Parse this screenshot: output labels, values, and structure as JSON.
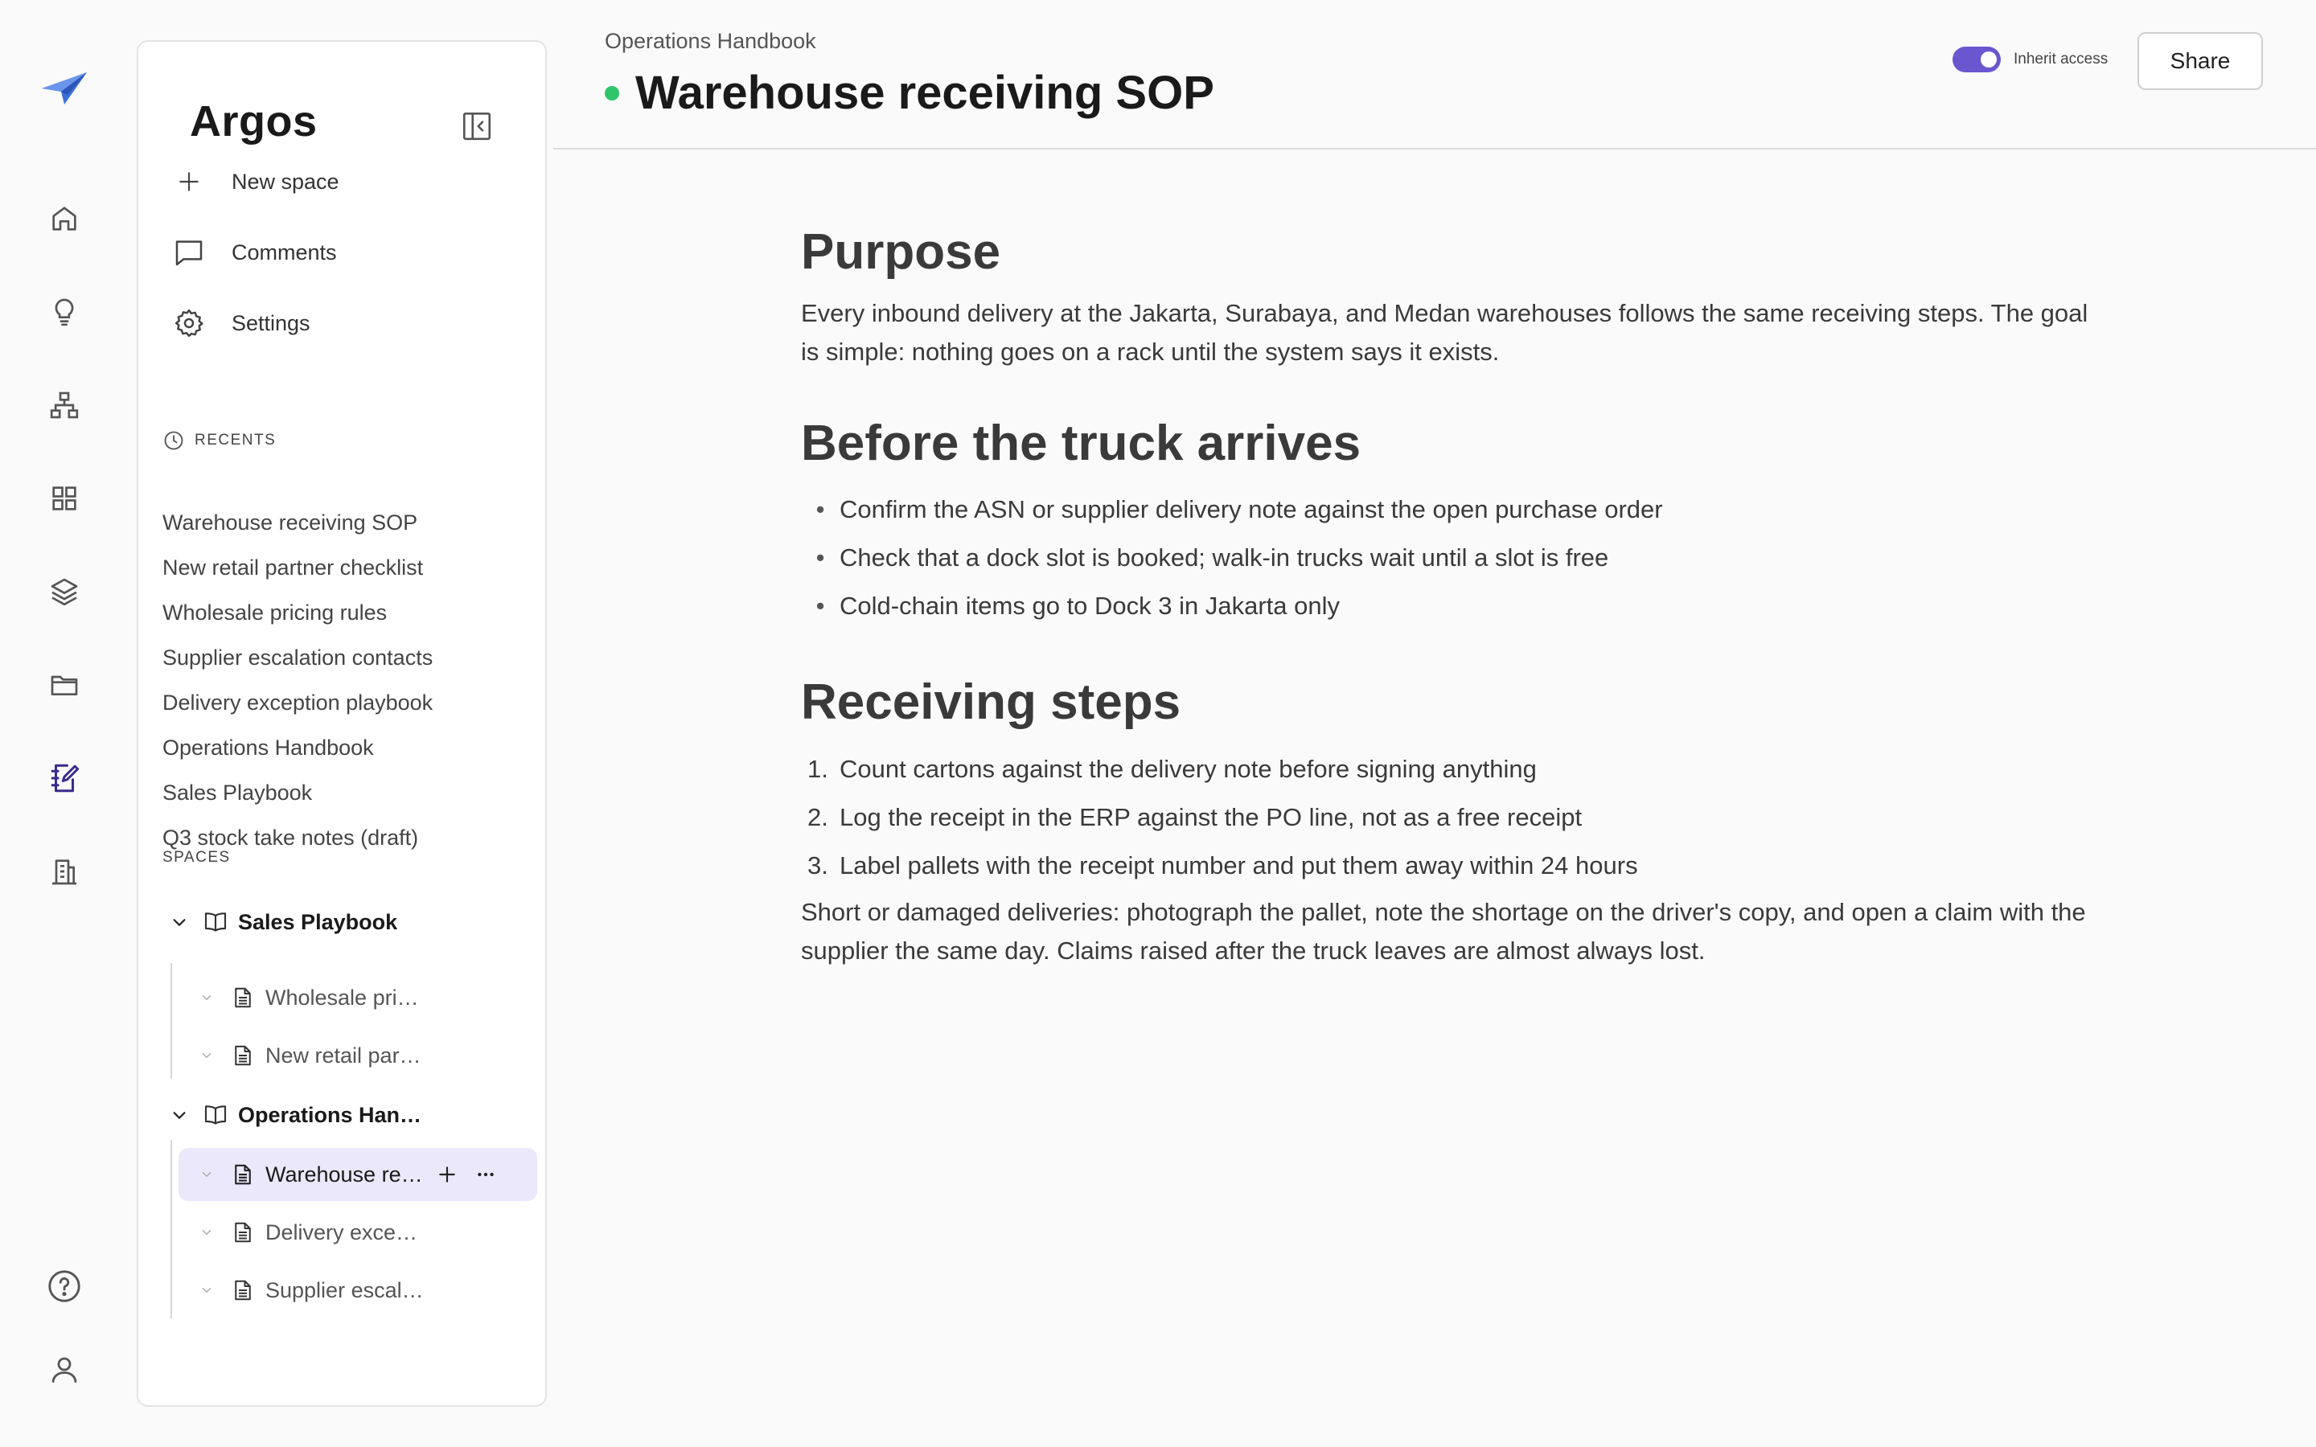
{
  "rail": {
    "items": [
      {
        "icon": "home-icon"
      },
      {
        "icon": "lightbulb-icon"
      },
      {
        "icon": "org-chart-icon"
      },
      {
        "icon": "grid-icon"
      },
      {
        "icon": "layers-icon"
      },
      {
        "icon": "folder-icon"
      },
      {
        "icon": "notebook-edit-icon",
        "active": true
      },
      {
        "icon": "building-icon"
      }
    ],
    "bottom": [
      {
        "icon": "help-icon"
      },
      {
        "icon": "user-icon"
      }
    ]
  },
  "sidebar": {
    "workspace": "Argos",
    "menu": {
      "new_space": "New space",
      "comments": "Comments",
      "settings": "Settings"
    },
    "recents_label": "RECENTS",
    "recents": [
      "Warehouse receiving SOP",
      "New retail partner checklist",
      "Wholesale pricing rules",
      "Supplier escalation contacts",
      "Delivery exception playbook",
      "Operations Handbook",
      "Sales Playbook",
      "Q3 stock take notes (draft)"
    ],
    "spaces_label": "SPACES",
    "tree": {
      "sales": "Sales Playbook",
      "sales_pages": [
        "Wholesale pri…",
        "New retail par…"
      ],
      "ops": "Operations Han…",
      "ops_selected": "Warehouse re…",
      "ops_pages": [
        "Delivery exce…",
        "Supplier escal…"
      ]
    }
  },
  "header": {
    "breadcrumb": "Operations Handbook",
    "title": "Warehouse receiving SOP",
    "status_color": "#2ec56a",
    "inherit_access": "Inherit access",
    "share": "Share",
    "accent": "#6a56cf"
  },
  "doc": {
    "purpose_heading": "Purpose",
    "purpose_text": "Every inbound delivery at the Jakarta, Surabaya, and Medan warehouses follows the same receiving steps. The goal is simple: nothing goes on a rack until the system says it exists.",
    "before_heading": "Before the truck arrives",
    "before_items": [
      "Confirm the ASN or supplier delivery note against the open purchase order",
      "Check that a dock slot is booked; walk-in trucks wait until a slot is free",
      "Cold-chain items go to Dock 3 in Jakarta only"
    ],
    "steps_heading": "Receiving steps",
    "steps": [
      "Count cartons against the delivery note before signing anything",
      "Log the receipt in the ERP against the PO line, not as a free receipt",
      "Label pallets with the receipt number and put them away within 24 hours"
    ],
    "closing_text": "Short or damaged deliveries: photograph the pallet, note the shortage on the driver's copy, and open a claim with the supplier the same day. Claims raised after the truck leaves are almost always lost."
  }
}
